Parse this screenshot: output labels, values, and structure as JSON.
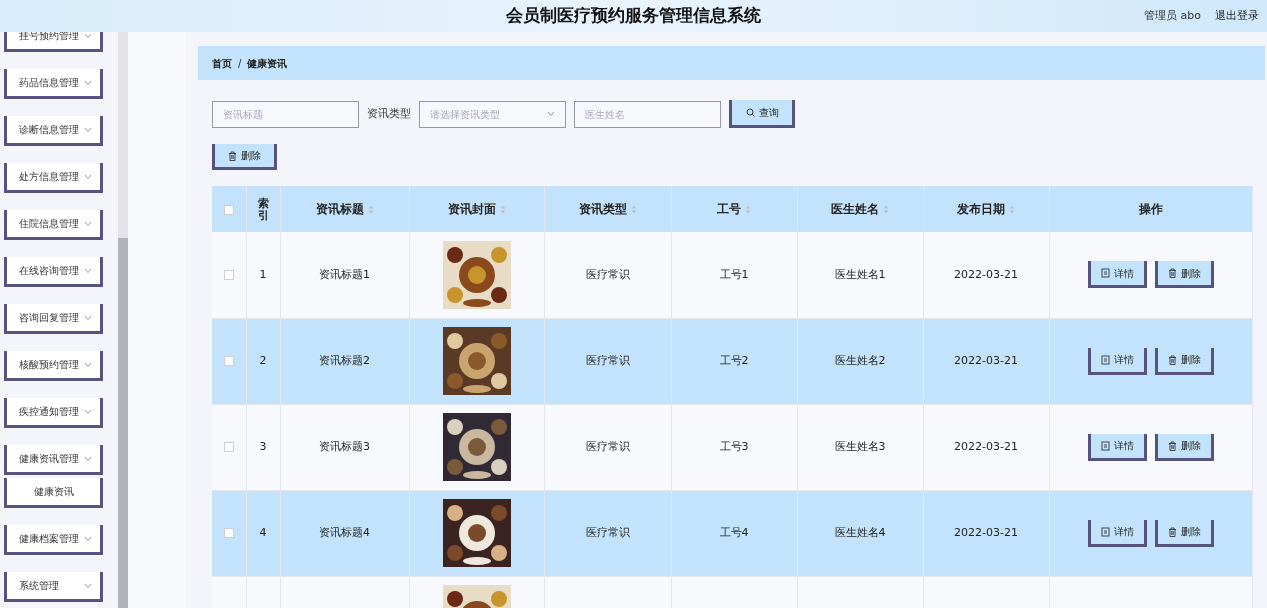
{
  "header": {
    "title": "会员制医疗预约服务管理信息系统",
    "user": "管理员 abo",
    "logout": "退出登录"
  },
  "sidebar": {
    "items": [
      {
        "label": "挂号预约管理"
      },
      {
        "label": "药品信息管理"
      },
      {
        "label": "诊断信息管理"
      },
      {
        "label": "处方信息管理"
      },
      {
        "label": "住院信息管理"
      },
      {
        "label": "在线咨询管理"
      },
      {
        "label": "咨询回复管理"
      },
      {
        "label": "核酸预约管理"
      },
      {
        "label": "疾控通知管理"
      },
      {
        "label": "健康资讯管理",
        "children": [
          {
            "label": "健康资讯"
          }
        ]
      },
      {
        "label": "健康档案管理"
      },
      {
        "label": "系统管理"
      }
    ]
  },
  "breadcrumb": [
    "首页",
    "/",
    "健康资讯"
  ],
  "search": {
    "title_placeholder": "资讯标题",
    "type_label": "资讯类型",
    "type_placeholder": "请选择资讯类型",
    "doctor_placeholder": "医生姓名",
    "query_button": "查询"
  },
  "delete_button": "删除",
  "table": {
    "select_all_checked": false,
    "columns": [
      {
        "label": "索引",
        "sortable": false
      },
      {
        "label": "资讯标题",
        "sortable": true
      },
      {
        "label": "资讯封面",
        "sortable": true
      },
      {
        "label": "资讯类型",
        "sortable": true
      },
      {
        "label": "工号",
        "sortable": true
      },
      {
        "label": "医生姓名",
        "sortable": true
      },
      {
        "label": "发布日期",
        "sortable": true
      },
      {
        "label": "操作",
        "sortable": false
      }
    ],
    "rows": [
      {
        "kind": "full",
        "selected": false,
        "index": "1",
        "title": "资讯标题1",
        "cover": {
          "kind": "picture"
        },
        "type": "医疗常识",
        "staff_no": "工号1",
        "doctor": "医生姓名1",
        "date": "2022-03-21",
        "actions": [
          "详情",
          "删除"
        ]
      },
      {
        "kind": "full",
        "selected": false,
        "index": "2",
        "title": "资讯标题2",
        "cover": {
          "kind": "picture"
        },
        "type": "医疗常识",
        "staff_no": "工号2",
        "doctor": "医生姓名2",
        "date": "2022-03-21",
        "actions": [
          "详情",
          "删除"
        ]
      },
      {
        "kind": "full",
        "selected": false,
        "index": "3",
        "title": "资讯标题3",
        "cover": {
          "kind": "picture"
        },
        "type": "医疗常识",
        "staff_no": "工号3",
        "doctor": "医生姓名3",
        "date": "2022-03-21",
        "actions": [
          "详情",
          "删除"
        ]
      },
      {
        "kind": "full",
        "selected": false,
        "index": "4",
        "title": "资讯标题4",
        "cover": {
          "kind": "picture"
        },
        "type": "医疗常识",
        "staff_no": "工号4",
        "doctor": "医生姓名4",
        "date": "2022-03-21",
        "actions": [
          "详情",
          "删除"
        ]
      },
      {
        "kind": "cut",
        "cover": {
          "kind": "picture"
        }
      }
    ]
  }
}
